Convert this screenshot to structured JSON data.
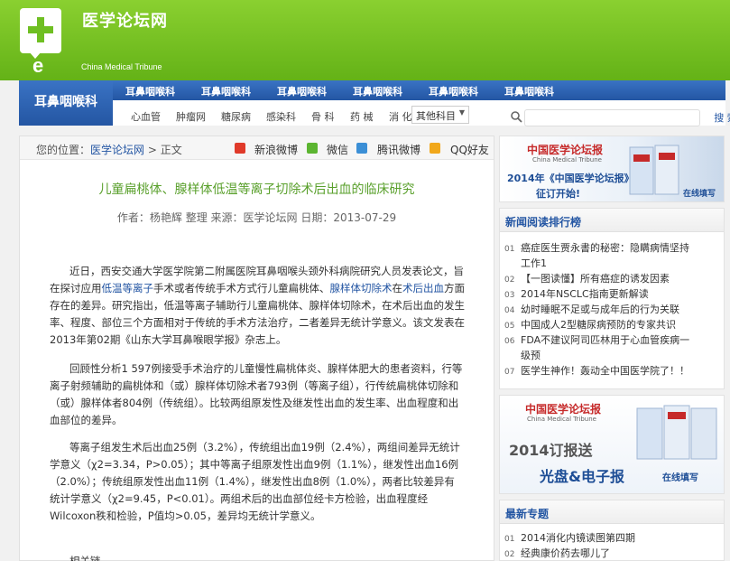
{
  "header": {
    "site_title": "医学论坛网",
    "site_subtitle": "China Medical Tribune",
    "brand_color": "#6fbf22",
    "nav_color": "#2b5fae"
  },
  "nav": {
    "section_label": "耳鼻咽喉科",
    "row1": [
      "耳鼻咽喉科",
      "耳鼻咽喉科",
      "耳鼻咽喉科",
      "耳鼻咽喉科",
      "耳鼻咽喉科",
      "耳鼻咽喉科"
    ],
    "row2": [
      "心血管",
      "肿瘤网",
      "糖尿病",
      "感染科",
      "骨 科",
      "药 械",
      "消 化"
    ],
    "dropdown": "其他科目",
    "search_button": "搜 索"
  },
  "breadcrumb": {
    "prefix": "您的位置：",
    "home": "医学论坛网",
    "sep": " > ",
    "current": "正文"
  },
  "share": {
    "weibo_sina": "新浪微博",
    "weixin": "微信",
    "weibo_tencent": "腾讯微博",
    "qq": "QQ好友"
  },
  "article": {
    "title": "儿童扁桃体、腺样体低温等离子切除术后出血的临床研究",
    "meta": "作者：杨艳辉 整理 来源：医学论坛网 日期：2013-07-29",
    "p1_a": "近日，西安交通大学医学院第二附属医院耳鼻咽喉头颈外科病院研究人员发表论文，旨在探讨应用",
    "p1_link1": "低温等离子",
    "p1_b": "手术或者传统手术方式行儿童扁桃体、",
    "p1_link2": "腺样体切除术",
    "p1_c": "在",
    "p1_link3": "术后出血",
    "p1_d": "方面存在的差异。研究指出，低温等离子辅助行儿童扁桃体、腺样体切除术，在术后出血的发生率、程度、部位三个方面相对于传统的手术方法治疗，二者差异无统计学意义。该文发表在2013年第02期《山东大学耳鼻喉眼学报》杂志上。",
    "p2": "回顾性分析1 597例接受手术治疗的儿童慢性扁桃体炎、腺样体肥大的患者资料，行等离子射频辅助的扁桃体和（或）腺样体切除术者793例（等离子组），行传统扁桃体切除和（或）腺样体者804例（传统组）。比较两组原发性及继发性出血的发生率、出血程度和出血部位的差异。",
    "p3": "等离子组发生术后出血25例（3.2%），传统组出血19例（2.4%），两组间差异无统计学意义（χ2=3.34，P>0.05）；其中等离子组原发性出血9例（1.1%），继发性出血16例（2.0%）；传统组原发性出血11例（1.4%），继发性出血8例（1.0%），两者比较差异有统计学意义（χ2=9.45，P<0.01）。两组术后的出血部位经卡方检验，出血程度经Wilcoxon秩和检验，P值均>0.05，差异均无统计学意义。",
    "p4": "相关链"
  },
  "ad_top": {
    "brand": "中国医学论坛报",
    "brand_en": "China Medical Tribune",
    "line1": "2014年《中国医学论坛报》",
    "line2": "征订开始!",
    "link": "在线填写"
  },
  "ranking": {
    "heading": "新闻阅读排行榜",
    "items": [
      {
        "num": "01",
        "text": "癌症医生贾永書的秘密：隐瞒病情坚持"
      },
      {
        "num": "",
        "text": "工作1"
      },
      {
        "num": "02",
        "text": "【一图读懂】所有癌症的诱发因素"
      },
      {
        "num": "03",
        "text": "2014年NSCLC指南更新解读"
      },
      {
        "num": "04",
        "text": "幼时睡眠不足或与成年后的行为关联"
      },
      {
        "num": "05",
        "text": "中国成人2型糖尿病预防的专家共识"
      },
      {
        "num": "06",
        "text": "FDA不建议阿司匹林用于心血管疾病一"
      },
      {
        "num": "",
        "text": "级预"
      },
      {
        "num": "07",
        "text": "医学生神作！轰动全中国医学院了！！"
      }
    ]
  },
  "ad_mid": {
    "brand": "中国医学论坛报",
    "brand_en": "China Medical Tribune",
    "line1": "2014订报送",
    "line2": "光盘&电子报",
    "link": "在线填写"
  },
  "topics": {
    "heading": "最新专题",
    "items": [
      {
        "num": "01",
        "text": "2014消化内镜读图第四期"
      },
      {
        "num": "02",
        "text": "经典康价药去哪儿了"
      }
    ]
  }
}
